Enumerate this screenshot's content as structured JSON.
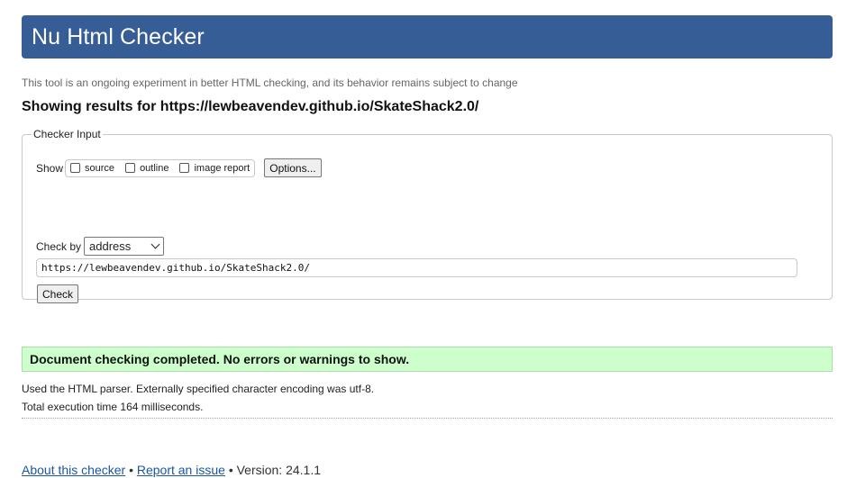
{
  "header": {
    "title": "Nu Html Checker"
  },
  "tagline": "This tool is an ongoing experiment in better HTML checking, and its behavior remains subject to change",
  "showing_results": "Showing results for https://lewbeavendev.github.io/SkateShack2.0/",
  "checker_input": {
    "legend": "Checker Input",
    "show_label": "Show",
    "checkboxes": [
      {
        "label": "source",
        "checked": false
      },
      {
        "label": "outline",
        "checked": false
      },
      {
        "label": "image report",
        "checked": false
      }
    ],
    "options_label": "Options...",
    "check_by_label": "Check by",
    "check_by_selected": "address",
    "url_value": "https://lewbeavendev.github.io/SkateShack2.0/",
    "check_button_label": "Check"
  },
  "result": {
    "message": "Document checking completed. No errors or warnings to show.",
    "parser_info": "Used the HTML parser. Externally specified character encoding was utf-8.",
    "execution_time": "Total execution time 164 milliseconds."
  },
  "footer": {
    "about_link": "About this checker",
    "separator": "•",
    "report_link": "Report an issue",
    "version": "Version: 24.1.1"
  },
  "colors": {
    "header_bg": "#365d95",
    "success_bg": "#ccffcc",
    "link": "#1a56a6"
  }
}
